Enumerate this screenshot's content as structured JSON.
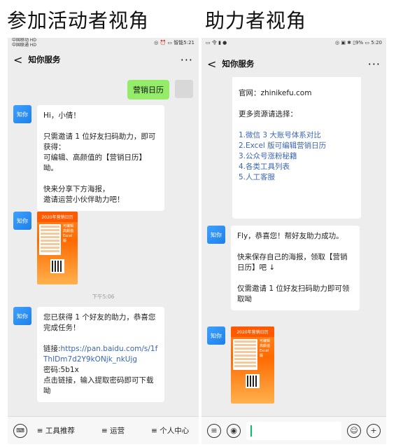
{
  "headings": {
    "left": "参加活动者视角",
    "right": "助力者视角"
  },
  "left_phone": {
    "status": {
      "carrier": "中国移动 HD\n中国联通 HD",
      "icons": "◎ ⏰ ▭ 智能5:21"
    },
    "navbar": {
      "back": "<",
      "title": "知你服务",
      "more": "···"
    },
    "user_message": "营销日历",
    "avatar_label": "知你",
    "msg1": [
      "Hi，小倩！",
      "",
      "只需邀请 1 位好友扫码助力，即可获得：",
      "可编辑、高颜值的【营销日历】呦。",
      "",
      "快来分享下方海报，",
      "邀请运营小伙伴助力吧！"
    ],
    "poster": {
      "title": "2020年营销日历",
      "text": "可编辑 高颜值 Excel版"
    },
    "timestamp": "下午5:06",
    "msg2": {
      "line1": "您已获得 1 个好友的助力，恭喜您完成任务！",
      "link_label": "链接:",
      "link_url": "https://pan.baidu.com/s/1fThIDm7d2Y9kONjk_nkUjg",
      "code": "密码:5b1x",
      "tip": "点击链接，输入提取密码即可下载呦"
    },
    "bottom_menu": [
      "≡ 工具推荐",
      "≡ 运营",
      "≡ 个人中心"
    ]
  },
  "right_phone": {
    "status": {
      "left": "▭ 令 ▮ ●",
      "right": "◎ ▣ ✱ ▯9% ▭ 5:20"
    },
    "navbar": {
      "back": "<",
      "title": "知你服务",
      "more": "···"
    },
    "avatar_label": "知你",
    "msg0": {
      "site": "官网：zhinikefu.com",
      "more": "更多资源请选择：",
      "items": [
        "1.微信 3 大账号体系对比",
        "2.Excel 版可编辑营销日历",
        "3.公众号涨粉秘籍",
        "4.各类工具列表",
        "5.人工客服"
      ]
    },
    "msg1": [
      "Fly，恭喜您！帮好友助力成功。",
      "",
      "快来保存自己的海报，领取【营销日历】吧 ↓",
      "",
      "仅需邀请 1 位好友扫码助力即可领取呦"
    ],
    "poster": {
      "title": "2020年营销日历",
      "text": "可编辑 高颜值 Excel版"
    }
  },
  "colors": {
    "accent_green": "#95ec69",
    "avatar_blue": "#1f7fe8",
    "link_blue": "#3a66b3",
    "chat_bg": "#ededed"
  }
}
